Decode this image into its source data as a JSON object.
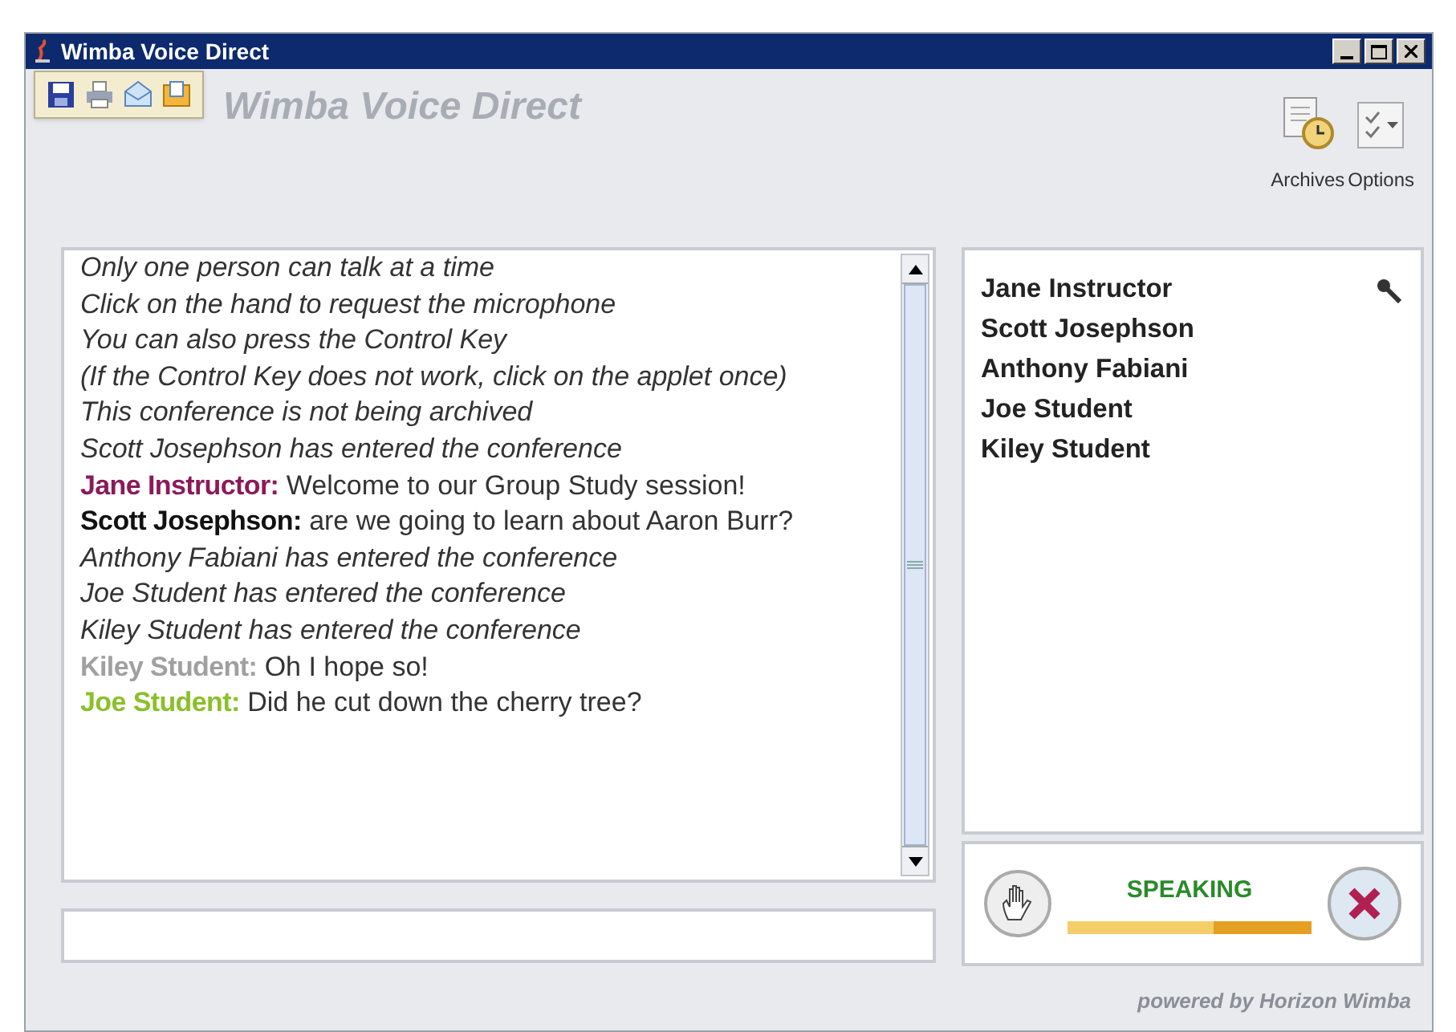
{
  "window": {
    "title": "Wimba Voice Direct"
  },
  "toolbar": {
    "items": [
      {
        "kind": "save"
      },
      {
        "kind": "print"
      },
      {
        "kind": "email"
      },
      {
        "kind": "export"
      }
    ]
  },
  "logo": "Wimba Voice Direct",
  "top_buttons": [
    {
      "kind": "archives",
      "label": "Archives"
    },
    {
      "kind": "options",
      "label": "Options"
    }
  ],
  "messages": [
    {
      "kind": "system",
      "text": "Only one person can talk at a time"
    },
    {
      "kind": "system",
      "text": "Click on the hand to request the microphone"
    },
    {
      "kind": "system",
      "text": "You can also press the Control Key"
    },
    {
      "kind": "system",
      "text": "(If the Control Key does not work, click on the applet once)"
    },
    {
      "kind": "system",
      "text": "This conference is not being archived"
    },
    {
      "kind": "system",
      "text": "Scott Josephson has entered the conference"
    },
    {
      "kind": "chat",
      "speaker": "Jane Instructor:",
      "color": "#8b1a5a",
      "text": "Welcome to our Group Study session!"
    },
    {
      "kind": "chat",
      "speaker": "Scott Josephson:",
      "color": "#111111",
      "text": "are we going to learn about Aaron Burr?"
    },
    {
      "kind": "system",
      "text": "Anthony Fabiani has entered the conference"
    },
    {
      "kind": "system",
      "text": "Joe Student has entered the conference"
    },
    {
      "kind": "system",
      "text": "Kiley Student has entered the conference"
    },
    {
      "kind": "chat",
      "speaker": "Kiley Student:",
      "color": "#a0a0a0",
      "text": "Oh I hope so!"
    },
    {
      "kind": "chat",
      "speaker": "Joe Student:",
      "color": "#8cbf2a",
      "text": "Did he cut down the cherry tree?"
    }
  ],
  "participants": [
    {
      "name": "Jane Instructor",
      "has_mic": true
    },
    {
      "name": "Scott Josephson",
      "has_mic": false
    },
    {
      "name": "Anthony Fabiani",
      "has_mic": false
    },
    {
      "name": "Joe Student",
      "has_mic": false
    },
    {
      "name": "Kiley Student",
      "has_mic": false
    }
  ],
  "speaking": {
    "status": "SPEAKING",
    "level": 0.6
  },
  "footer": "powered by Horizon Wimba"
}
